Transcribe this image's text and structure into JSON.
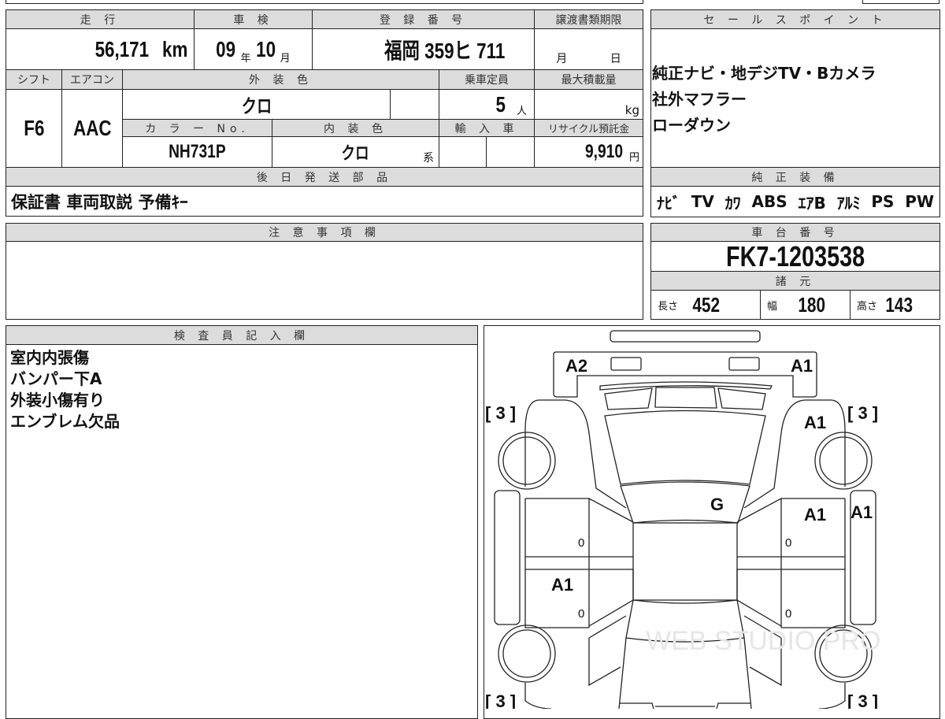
{
  "top_table": {
    "headers": {
      "mileage": "走 行",
      "inspection": "車 検",
      "registration": "登 録 番 号",
      "transfer_deadline": "譲渡書類期限",
      "shift": "シフト",
      "aircon": "エアコン",
      "exterior_color": "外 装 色",
      "capacity": "乗車定員",
      "max_load": "最大積載量",
      "color_no": "カ ラ ー No.",
      "interior_color": "内 装 色",
      "imported": "輸 入 車",
      "recycle_fee": "リサイクル預託金",
      "later_parts": "後 日 発 送 部 品"
    },
    "mileage": "56,171",
    "mileage_unit": "km",
    "inspection_year": "09",
    "year_unit": "年",
    "inspection_month": "10",
    "month_unit": "月",
    "registration": "福岡 359ヒ 711",
    "deadline_month": "月",
    "deadline_day": "日",
    "shift": "F6",
    "aircon": "AAC",
    "exterior_color": "クロ",
    "capacity": "5",
    "capacity_unit": "人",
    "max_load_unit": "kg",
    "color_no": "NH731P",
    "interior_color": "クロ",
    "interior_suffix": "系",
    "recycle_fee": "9,910",
    "yen": "円",
    "later_parts": "保証書 車両取説 予備ｷｰ"
  },
  "sales_point": {
    "header": "セ ー ル ス ポ イ ン ト",
    "lines": [
      "純正ナビ・地デジTV・Bカメラ",
      "社外マフラー",
      "ローダウン"
    ]
  },
  "equipment": {
    "header": "純 正 装 備",
    "items": [
      "ﾅﾋﾞ",
      "TV",
      "ｶﾜ",
      "ABS",
      "ｴｱB",
      "ｱﾙﾐ",
      "PS",
      "PW"
    ]
  },
  "notes": {
    "header": "注 意 事 項 欄"
  },
  "chassis": {
    "header": "車 台 番 号",
    "number": "FK7-1203538",
    "spec_header": "諸 元",
    "length_label": "長さ",
    "length": "452",
    "width_label": "幅",
    "width": "180",
    "height_label": "高さ",
    "height": "143"
  },
  "inspector": {
    "header": "検 査 員 記 入 欄",
    "lines": [
      "室内内張傷",
      "バンパー下A",
      "外装小傷有り",
      "エンブレム欠品"
    ]
  },
  "diagram": {
    "marks": {
      "front_left": "A2",
      "front_right": "A1",
      "fender_right": "A1",
      "windshield": "G",
      "door_front_right": "A1",
      "skirt_right": "A1",
      "door_rear_left": "A1",
      "bracket": "[ 3 ]",
      "zero": "0"
    },
    "watermark": "WEB STUDIO PRO"
  }
}
